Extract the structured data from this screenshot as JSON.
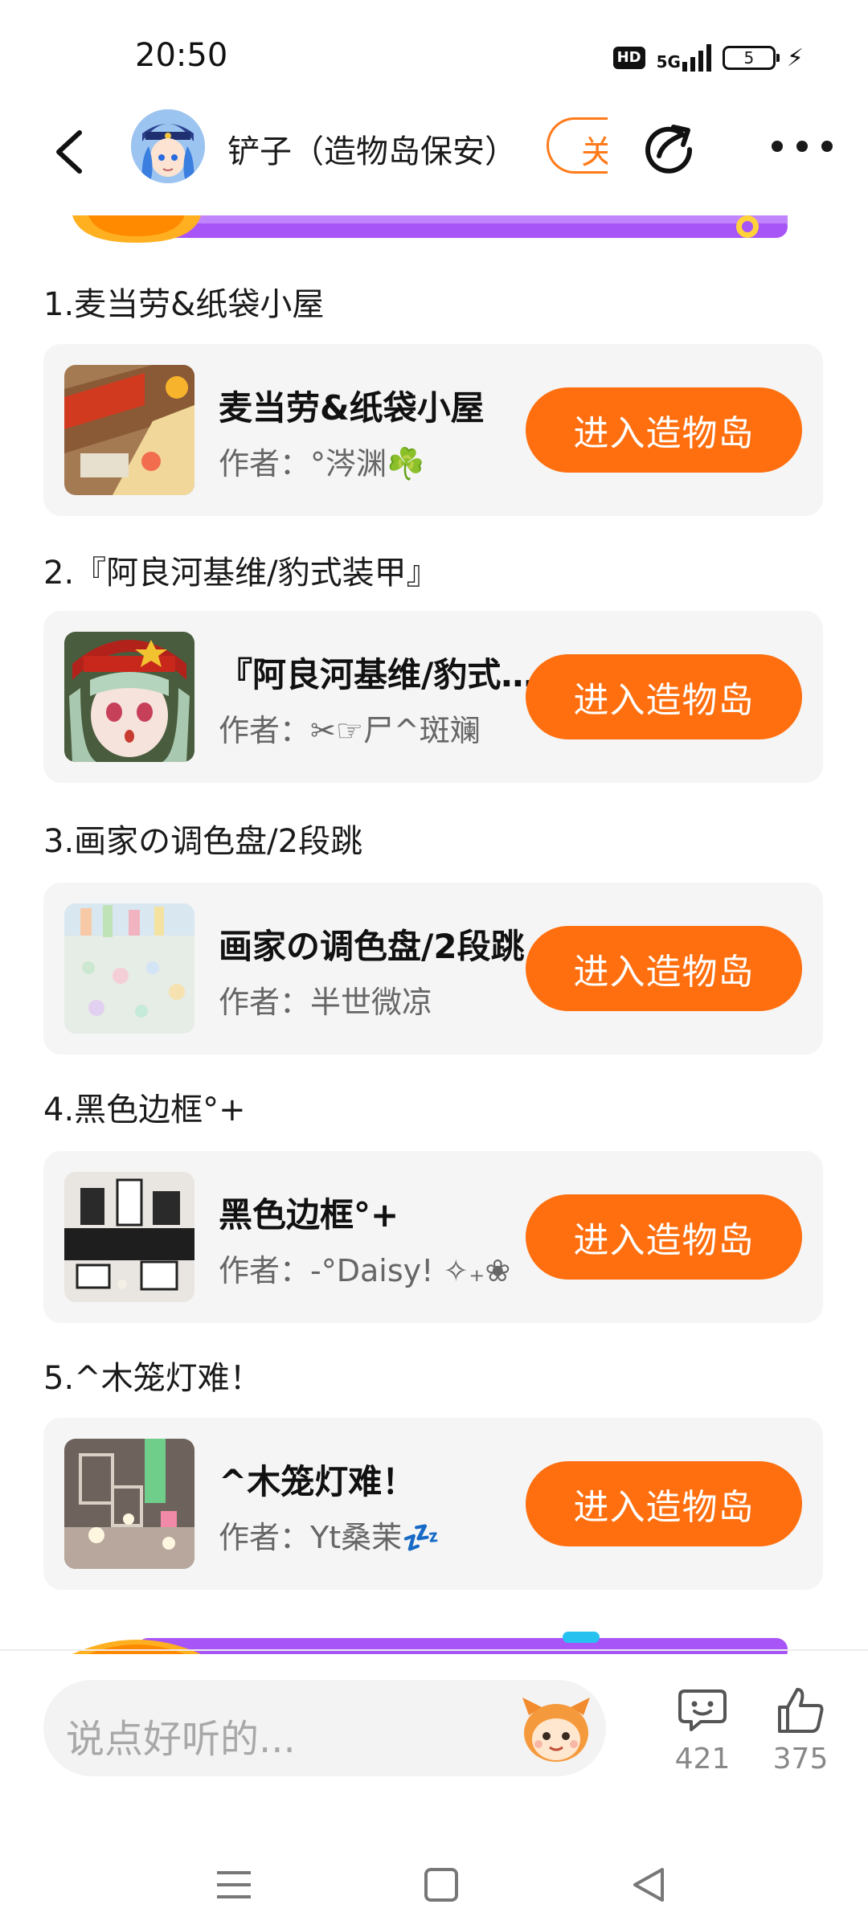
{
  "status_bar": {
    "time": "20:50",
    "hd_label": "HD",
    "network_label": "5G",
    "battery_level": "5"
  },
  "header": {
    "title": "铲子（造物岛保安）",
    "follow_label_partial": "关",
    "icons": [
      "back-icon",
      "share-icon",
      "more-icon"
    ]
  },
  "items": [
    {
      "section_title": "1.麦当劳&纸袋小屋",
      "name": "麦当劳&纸袋小屋",
      "author": "作者：°涔渊☘️",
      "button": "进入造物岛"
    },
    {
      "section_title": "2.『阿良河基维/豹式装甲』",
      "name": "『阿良河基维/豹式装甲』",
      "author": "作者：✂☞尸^斑斓",
      "button": "进入造物岛"
    },
    {
      "section_title": "3.画家の调色盘/2段跳",
      "name": "画家の调色盘/2段跳",
      "author": "作者：半世微凉",
      "button": "进入造物岛"
    },
    {
      "section_title": "4.黑色边框°+",
      "name": "黑色边框°+",
      "author": "作者：-°Daisy! ✧₊❀",
      "button": "进入造物岛"
    },
    {
      "section_title": "5.^木笼灯难！",
      "name": "^木笼灯难！",
      "author": "作者：Yt桑茉💤",
      "button": "进入造物岛"
    }
  ],
  "bottom_bar": {
    "comment_placeholder": "说点好听的...",
    "comment_count": "421",
    "like_count": "375"
  },
  "colors": {
    "accent": "#ff6f0f",
    "card_bg": "#f5f5f5",
    "banner_purple": "#a855f7"
  }
}
